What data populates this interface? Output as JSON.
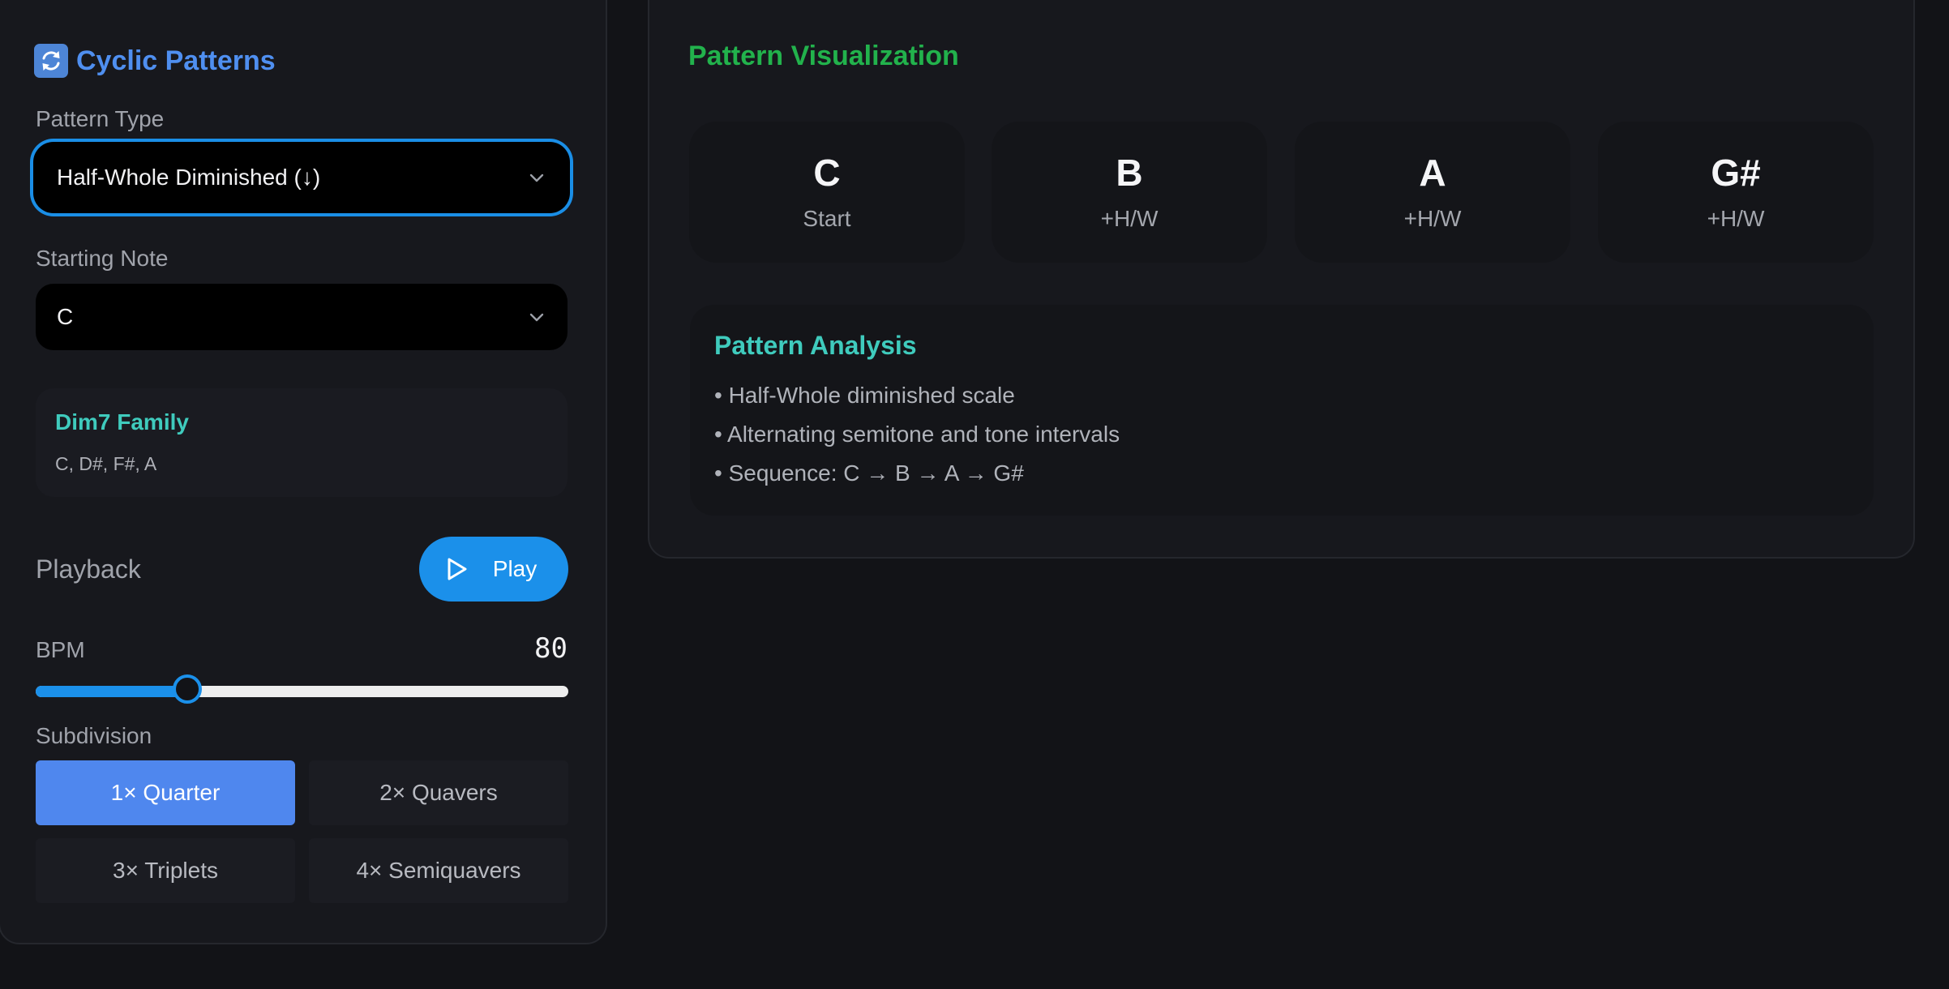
{
  "sidebar": {
    "title": "Cyclic Patterns",
    "title_icon": "refresh-icon",
    "pattern_type_label": "Pattern Type",
    "pattern_type_value": "Half-Whole Diminished (↓)",
    "starting_note_label": "Starting Note",
    "starting_note_value": "C",
    "family": {
      "title": "Dim7 Family",
      "notes": "C, D#, F#, A"
    },
    "playback_label": "Playback",
    "play_label": "Play",
    "bpm_label": "BPM",
    "bpm_value": "80",
    "bpm_slider_fraction": 0.285,
    "subdivision_label": "Subdivision",
    "subdivisions": [
      {
        "label": "1× Quarter",
        "active": true
      },
      {
        "label": "2× Quavers",
        "active": false
      },
      {
        "label": "3× Triplets",
        "active": false
      },
      {
        "label": "4× Semiquavers",
        "active": false
      }
    ]
  },
  "visualization": {
    "title": "Pattern Visualization",
    "notes": [
      {
        "name": "C",
        "step": "Start"
      },
      {
        "name": "B",
        "step": "+H/W"
      },
      {
        "name": "A",
        "step": "+H/W"
      },
      {
        "name": "G#",
        "step": "+H/W"
      }
    ],
    "analysis": {
      "title": "Pattern Analysis",
      "items": [
        "• Half-Whole diminished scale",
        "• Alternating semitone and tone intervals",
        "• Sequence: C → B → A → G#"
      ]
    }
  },
  "colors": {
    "accent_blue": "#1b90ea",
    "title_blue": "#4f8ff0",
    "teal": "#3fcbbd",
    "green": "#22b24c",
    "active_sub": "#4f87ee"
  }
}
